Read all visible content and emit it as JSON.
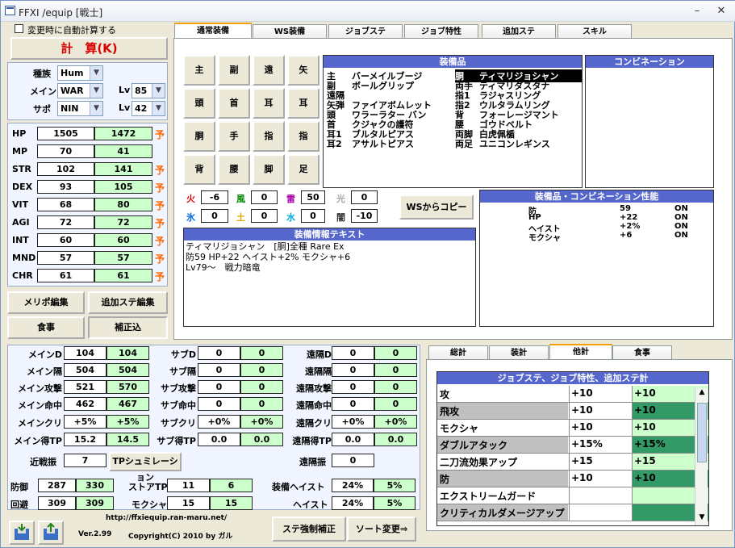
{
  "window": {
    "title": "FFXI /equip [戦士]"
  },
  "top": {
    "recalc_label": "変更時に自動計算する",
    "calc_label": "計　算(K)"
  },
  "job": {
    "race_label": "種族",
    "race": "Hum",
    "main_label": "メイン",
    "main": "WAR",
    "sub_label": "サポ",
    "sub": "NIN",
    "lv_label": "Lv",
    "main_lv": "85",
    "sub_lv": "42"
  },
  "stats": [
    {
      "name": "HP",
      "a": "1505",
      "b": "1472",
      "yo": "予"
    },
    {
      "name": "MP",
      "a": "70",
      "b": "41",
      "yo": ""
    },
    {
      "name": "STR",
      "a": "102",
      "b": "141",
      "yo": "予"
    },
    {
      "name": "DEX",
      "a": "93",
      "b": "105",
      "yo": "予"
    },
    {
      "name": "VIT",
      "a": "68",
      "b": "80",
      "yo": "予"
    },
    {
      "name": "AGI",
      "a": "72",
      "b": "72",
      "yo": "予"
    },
    {
      "name": "INT",
      "a": "60",
      "b": "60",
      "yo": "予"
    },
    {
      "name": "MND",
      "a": "57",
      "b": "57",
      "yo": "予"
    },
    {
      "name": "CHR",
      "a": "61",
      "b": "61",
      "yo": "予"
    }
  ],
  "left_buttons": {
    "merit": "メリポ編集",
    "addstat": "追加ステ編集",
    "meal": "食事",
    "correct": "補正込"
  },
  "tabs": [
    "通常装備",
    "WS装備",
    "ジョブステ",
    "ジョブ特性",
    "追加ステ",
    "スキル"
  ],
  "slots": [
    "主",
    "副",
    "遠",
    "矢",
    "頭",
    "首",
    "耳",
    "耳",
    "胴",
    "手",
    "指",
    "指",
    "背",
    "腰",
    "脚",
    "足"
  ],
  "equip": {
    "header": "装備品",
    "left_slots": [
      "主",
      "副",
      "遠隔",
      "矢弾",
      "頭",
      "首",
      "耳1",
      "耳2"
    ],
    "left_items": [
      "バーメイルブージ",
      "ボールグリップ",
      "",
      "ファイアボムレット",
      "ワラーラター バン",
      "クジャクの護符",
      "ブルタルピアス",
      "アサルトピアス"
    ],
    "right_slots": [
      "胴",
      "両手",
      "指1",
      "指2",
      "背",
      "腰",
      "両脚",
      "両足"
    ],
    "right_items": [
      "ティマリジョシャン",
      "ティマリダスタナ",
      "ラジャスリング",
      "ウルタラムリング",
      "フォーレージマント",
      "ゴウドベルト",
      "白虎佩楯",
      "ユニコンレギンス"
    ]
  },
  "combo_header": "コンビネーション",
  "elements": [
    {
      "name": "火",
      "value": "-6",
      "color": "#dd0000"
    },
    {
      "name": "風",
      "value": "0",
      "color": "#008800"
    },
    {
      "name": "雷",
      "value": "50",
      "color": "#aa00aa"
    },
    {
      "name": "光",
      "value": "0",
      "color": "#aaaaaa"
    },
    {
      "name": "氷",
      "value": "0",
      "color": "#0066dd"
    },
    {
      "name": "土",
      "value": "0",
      "color": "#ddaa00"
    },
    {
      "name": "水",
      "value": "0",
      "color": "#00aadd"
    },
    {
      "name": "闇",
      "value": "-10",
      "color": "#333333"
    }
  ],
  "ws_copy": "WSからコピー",
  "perf": {
    "header": "装備品・コンビネーション性能",
    "rows": [
      [
        "防",
        "59",
        "ON"
      ],
      [
        "HP",
        "+22",
        "ON"
      ],
      [
        "ヘイスト",
        "+2%",
        "ON"
      ],
      [
        "モクシャ",
        "+6",
        "ON"
      ]
    ]
  },
  "info": {
    "header": "装備情報テキスト",
    "line1": "ティマリジョシャン　[胴]全種 Rare Ex",
    "line2": "防59 HP+22 ヘイスト+2% モクシャ+6",
    "line3": "Lv79～　戦力暗竜"
  },
  "combat": {
    "main_d": [
      "メインD",
      "104",
      "104"
    ],
    "main_delay": [
      "メイン隔",
      "504",
      "504"
    ],
    "main_atk": [
      "メイン攻撃",
      "521",
      "570"
    ],
    "main_acc": [
      "メイン命中",
      "462",
      "467"
    ],
    "main_crit": [
      "メインクリ",
      "+5%",
      "+5%"
    ],
    "main_tp": [
      "メイン得TP",
      "15.2",
      "14.5"
    ],
    "sub_d": [
      "サブD",
      "0",
      "0"
    ],
    "sub_delay": [
      "サブ隔",
      "0",
      "0"
    ],
    "sub_atk": [
      "サブ攻撃",
      "0",
      "0"
    ],
    "sub_acc": [
      "サブ命中",
      "0",
      "0"
    ],
    "sub_crit": [
      "サブクリ",
      "+0%",
      "+0%"
    ],
    "sub_tp": [
      "サブ得TP",
      "0.0",
      "0.0"
    ],
    "rng_d": [
      "遠隔D",
      "0",
      "0"
    ],
    "rng_delay": [
      "遠隔隔",
      "0",
      "0"
    ],
    "rng_atk": [
      "遠隔攻撃",
      "0",
      "0"
    ],
    "rng_acc": [
      "遠隔命中",
      "0",
      "0"
    ],
    "rng_crit": [
      "遠隔クリ",
      "+0%",
      "+0%"
    ],
    "rng_tp": [
      "遠隔得TP",
      "0.0",
      "0.0"
    ],
    "melee_swing": [
      "近戦振",
      "7"
    ],
    "tp_sim": "TPシュミレーション",
    "rng_swing": [
      "遠隔振",
      "0"
    ],
    "def": [
      "防御",
      "287",
      "330"
    ],
    "eva": [
      "回避",
      "309",
      "309"
    ],
    "store_tp": [
      "ストアTP",
      "11",
      "6"
    ],
    "moksha": [
      "モクシャ",
      "15",
      "15"
    ],
    "eq_haste": [
      "装備ヘイスト",
      "24%",
      "5%"
    ],
    "haste": [
      "ヘイスト",
      "24%",
      "5%"
    ]
  },
  "footer": {
    "url": "http://ffxiequip.ran-maru.net/",
    "version": "Ver.2.99",
    "copyright": "Copyright(C) 2010 by ガル",
    "force_btn": "ステ強制補正",
    "sort_btn": "ソート変更⇒"
  },
  "right_tabs": [
    "総計",
    "装計",
    "他計",
    "食事"
  ],
  "job_table": {
    "header": "ジョブステ、ジョブ特性、追加ステ計",
    "rows": [
      {
        "name": "攻",
        "a": "+10",
        "b": "+10",
        "gray": false
      },
      {
        "name": "飛攻",
        "a": "+10",
        "b": "+10",
        "gray": true
      },
      {
        "name": "モクシャ",
        "a": "+10",
        "b": "+10",
        "gray": false
      },
      {
        "name": "ダブルアタック",
        "a": "+15%",
        "b": "+15%",
        "gray": true
      },
      {
        "name": "二刀流効果アップ",
        "a": "+15",
        "b": "+15",
        "gray": false
      },
      {
        "name": "防",
        "a": "+10",
        "b": "+10",
        "gray": true
      },
      {
        "name": "エクストリームガード",
        "a": "",
        "b": "",
        "gray": false
      },
      {
        "name": "クリティカルダメージアップ",
        "a": "",
        "b": "",
        "gray": true
      }
    ]
  }
}
